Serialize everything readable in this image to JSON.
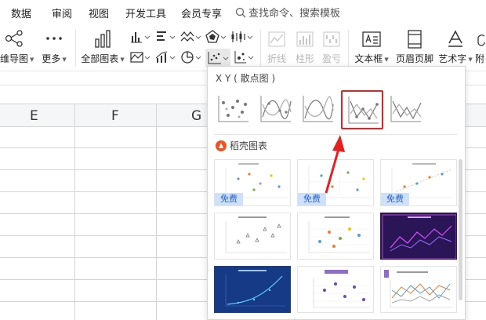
{
  "menu": {
    "tabs": [
      "数据",
      "审阅",
      "视图",
      "开发工具",
      "会员专享"
    ],
    "search_label": "查找命令、搜索模板"
  },
  "toolbar": {
    "mindmap_label": "维导图",
    "more_label": "更多",
    "all_charts_label": "全部图表",
    "sparkline_line": "折线",
    "sparkline_column": "柱形",
    "sparkline_winloss": "盈亏",
    "textbox_label": "文本框",
    "header_footer_label": "页眉页脚",
    "wordart_label": "艺术字",
    "cut_off_label": "附"
  },
  "sheet": {
    "columns": [
      "E",
      "F",
      "G"
    ]
  },
  "panel": {
    "xy_title": "X Y ( 散点图 )",
    "template_title": "稻壳图表",
    "free_badge": "免费",
    "selected_index": 3
  },
  "colors": {
    "highlight": "#e52020",
    "badge_bg": "#cfe0fb",
    "badge_text": "#2a62c9",
    "docer_orange": "#f0531f"
  }
}
